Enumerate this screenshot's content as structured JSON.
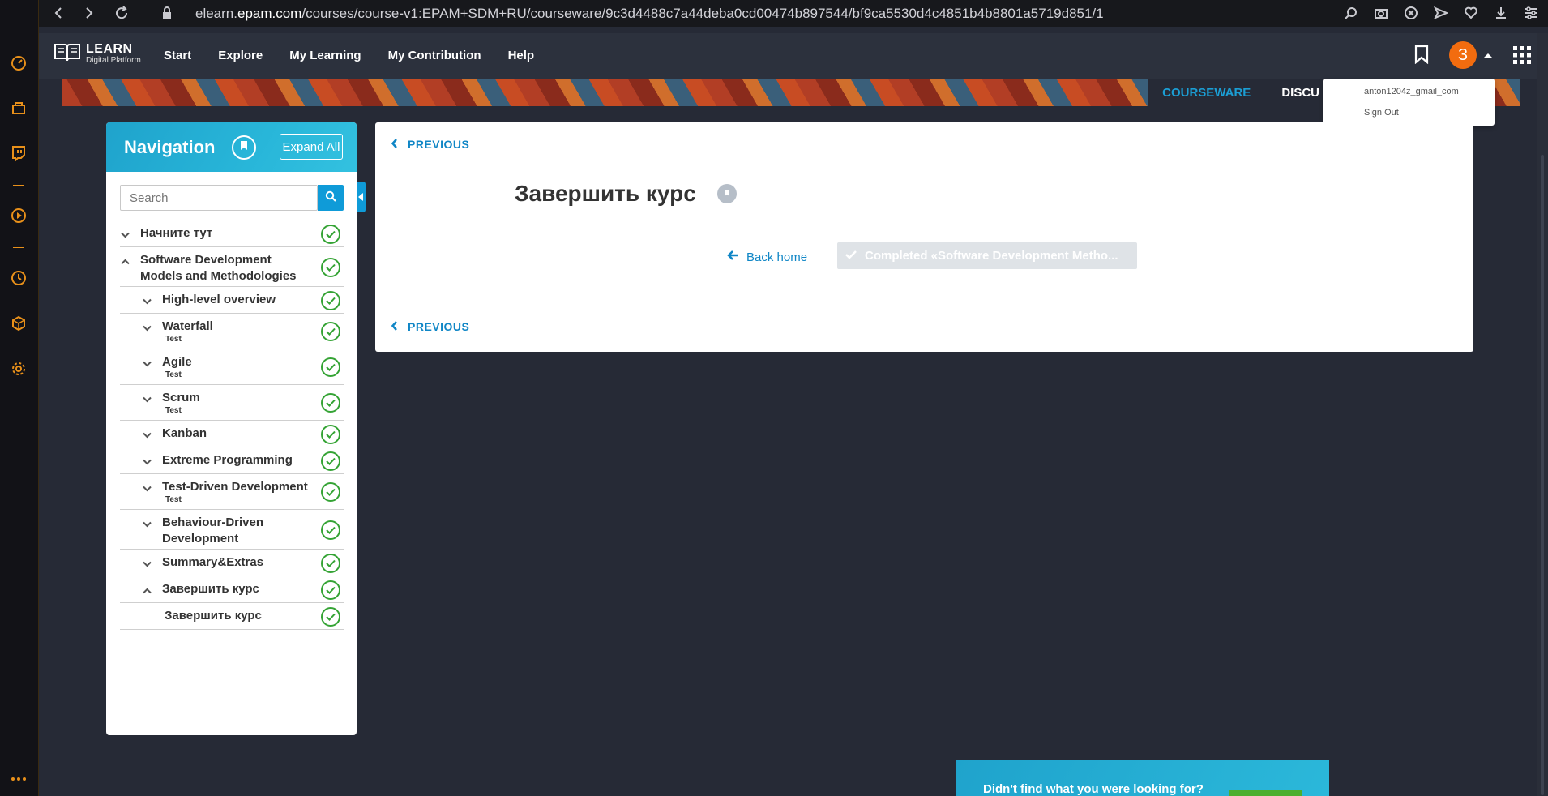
{
  "browser": {
    "url_prefix": "elearn.",
    "url_host": "epam.com",
    "url_path": "/courses/course-v1:EPAM+SDM+RU/courseware/9c3d4488c7a44deba0cd00474b897544/bf9ca5530d4c4851b4b8801a5719d851/1",
    "accent": "#e8901a"
  },
  "site": {
    "logo_title": "LEARN",
    "logo_sub": "Digital Platform",
    "nav": [
      "Start",
      "Explore",
      "My Learning",
      "My Contribution",
      "Help"
    ],
    "avatar_letter": "З",
    "brand_color": "#0f9bd8"
  },
  "banner_tabs": {
    "courseware": "COURSEWARE",
    "discussion": "DISCU"
  },
  "user_menu": {
    "email": "anton1204z_gmail_com",
    "sign_out": "Sign Out"
  },
  "navigation": {
    "title": "Navigation",
    "expand_all": "Expand All",
    "search_placeholder": "Search",
    "items": [
      {
        "label": "Начните тут",
        "level": 0,
        "expanded": false,
        "completed": true
      },
      {
        "label": "Software Development Models and Methodologies",
        "level": 0,
        "expanded": true,
        "completed": true
      },
      {
        "label": "High-level overview",
        "level": 1,
        "expanded": false,
        "completed": true
      },
      {
        "label": "Waterfall",
        "sub": "Test",
        "level": 1,
        "expanded": false,
        "completed": true
      },
      {
        "label": "Agile",
        "sub": "Test",
        "level": 1,
        "expanded": false,
        "completed": true
      },
      {
        "label": "Scrum",
        "sub": "Test",
        "level": 1,
        "expanded": false,
        "completed": true
      },
      {
        "label": "Kanban",
        "level": 1,
        "expanded": false,
        "completed": true
      },
      {
        "label": "Extreme Programming",
        "level": 1,
        "expanded": false,
        "completed": true
      },
      {
        "label": "Test-Driven Development",
        "sub": "Test",
        "level": 1,
        "expanded": false,
        "completed": true
      },
      {
        "label": "Behaviour-Driven Development",
        "level": 1,
        "expanded": false,
        "completed": true
      },
      {
        "label": "Summary&Extras",
        "level": 1,
        "expanded": false,
        "completed": true
      },
      {
        "label": "Завершить курс",
        "level": 1,
        "expanded": true,
        "completed": true
      },
      {
        "label": "Завершить курс",
        "level": 2,
        "expanded": false,
        "completed": true
      }
    ]
  },
  "content": {
    "previous": "PREVIOUS",
    "title": "Завершить курс",
    "back_home": "Back home",
    "completed_label": "Completed «Software Development Metho..."
  },
  "help": {
    "text": "Didn't find what you were looking for?"
  }
}
